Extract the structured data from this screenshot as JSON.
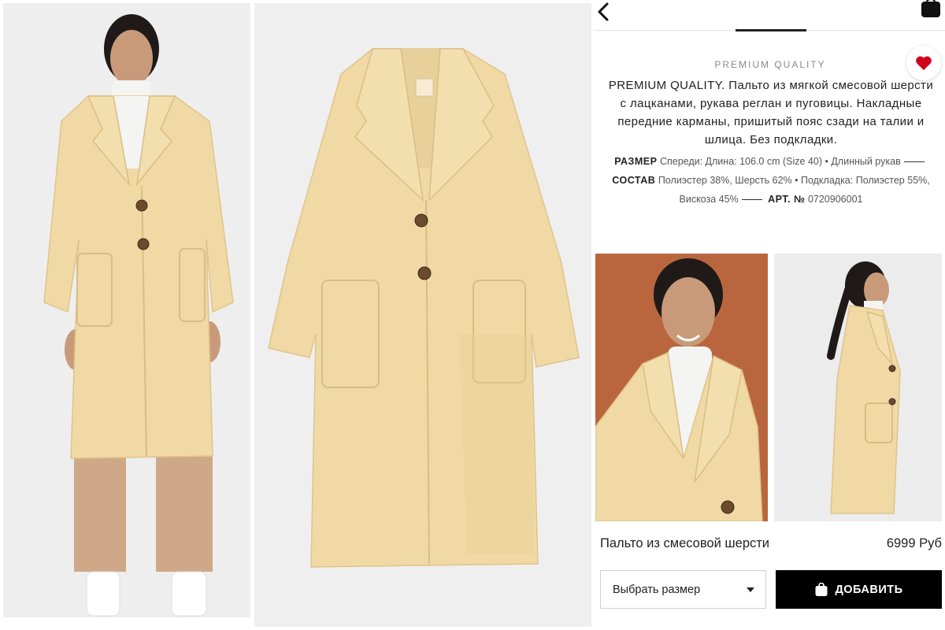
{
  "header": {
    "back_icon": "chevron-left-icon",
    "bag_icon": "shopping-bag-icon"
  },
  "section": {
    "heading": "PREMIUM QUALITY",
    "favorite_icon": "heart-icon",
    "favorite_color": "#d0021b"
  },
  "description": "PREMIUM QUALITY. Пальто из мягкой смесовой шерсти с лацканами, рукава реглан и пуговицы. Накладные передние карманы, пришитый пояс сзади на талии и шлица. Без подкладки.",
  "details": {
    "size_label": "РАЗМЕР",
    "size_value": "Спереди: Длина: 106.0 cm (Size 40) • Длинный рукав",
    "composition_label": "СОСТАВ",
    "composition_value": "Полиэстер 38%, Шерсть 62% • Подкладка: Полиэстер 55%, Вискоза 45%",
    "article_label": "АРТ. №",
    "article_value": "0720906001"
  },
  "product": {
    "name": "Пальто из смесовой шерсти",
    "price": "6999 Руб"
  },
  "actions": {
    "size_select_label": "Выбрать размер",
    "add_button_label": "ДОБАВИТЬ",
    "add_button_icon": "shopping-bag-icon"
  },
  "colors": {
    "coat": "#f0d9a4",
    "accent_black": "#000000",
    "heart_red": "#d0021b",
    "background_terracotta": "#b9663f"
  }
}
